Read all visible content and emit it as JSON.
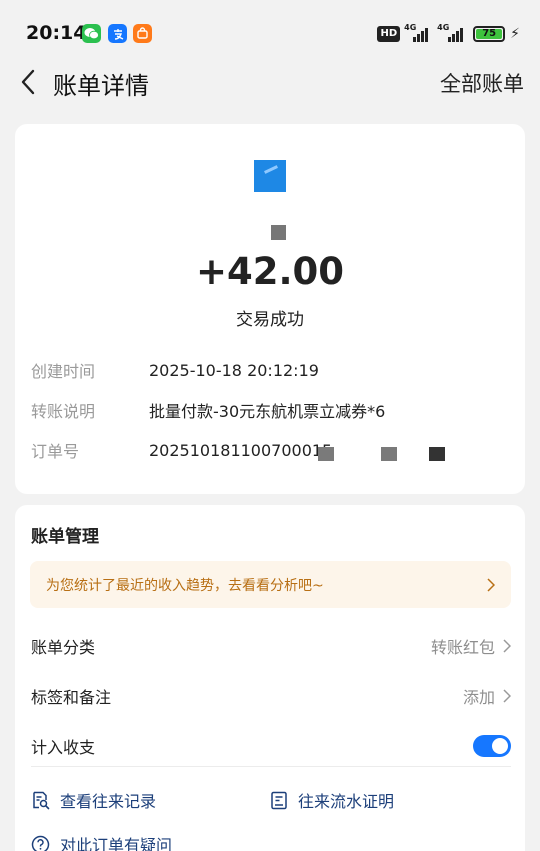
{
  "status_bar": {
    "time": "20:14",
    "apps": [
      "wechat-icon",
      "alipay-icon",
      "taobao-icon"
    ],
    "hd": "HD",
    "net1": "4G",
    "net2": "4G",
    "battery": "75"
  },
  "header": {
    "title": "账单详情",
    "all_bills": "全部账单"
  },
  "transaction": {
    "amount": "+42.00",
    "status": "交易成功",
    "details": [
      {
        "label": "创建时间",
        "value": "2025-10-18 20:12:19"
      },
      {
        "label": "转账说明",
        "value": "批量付款-30元东航机票立减券*6"
      },
      {
        "label": "订单号",
        "value": "202510181100700015"
      }
    ]
  },
  "management": {
    "title": "账单管理",
    "insight": "为您统计了最近的收入趋势，去看看分析吧~",
    "category_label": "账单分类",
    "category_value": "转账红包",
    "tags_label": "标签和备注",
    "tags_value": "添加",
    "include_label": "计入收支",
    "include_enabled": true,
    "history_link": "查看往来记录",
    "proof_link": "往来流水证明",
    "question_link": "对此订单有疑问"
  },
  "colors": {
    "accent": "#1677ff",
    "link": "#1c3f7a",
    "banner_bg": "#fdf5ea",
    "banner_text": "#b86f14"
  }
}
